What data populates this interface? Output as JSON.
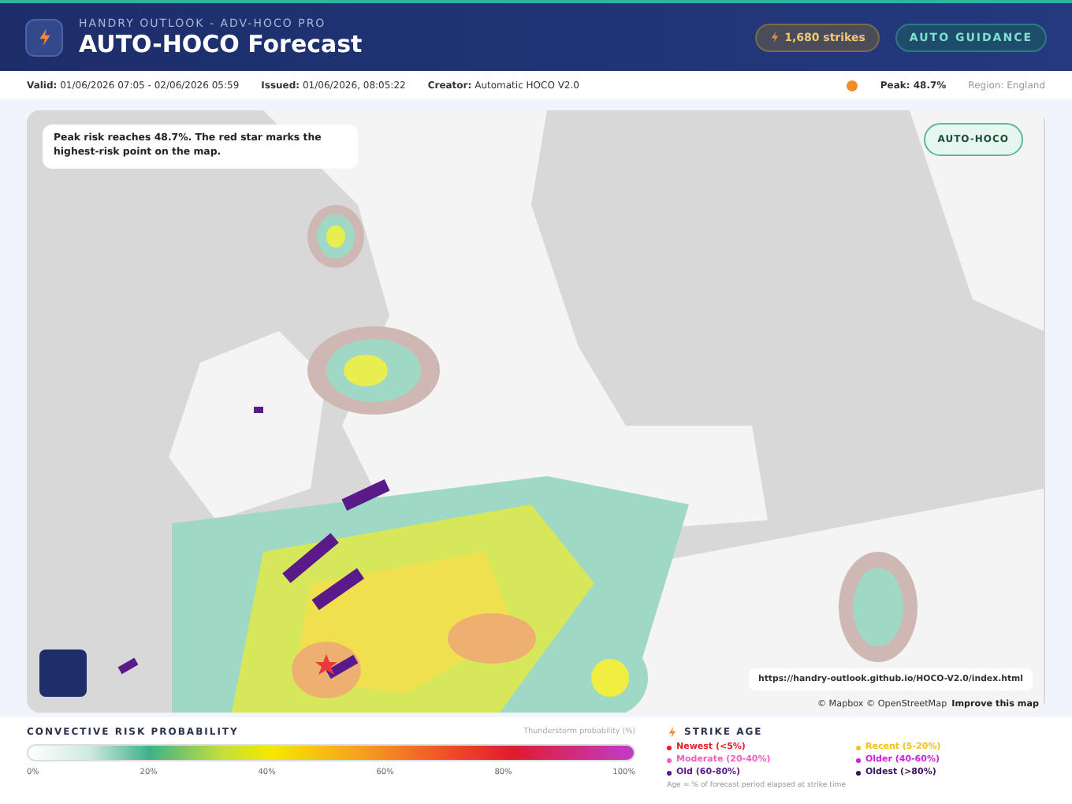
{
  "header": {
    "subtitle": "HANDRY OUTLOOK - ADV-HOCO PRO",
    "title": "AUTO-HOCO Forecast",
    "strikes": "1,680 strikes",
    "guidance": "AUTO GUIDANCE"
  },
  "info_bar": {
    "fields": [
      {
        "label": "Valid:",
        "value": "01/06/2026 07:05 - 02/06/2026 05:59"
      },
      {
        "label": "Issued:",
        "value": "01/06/2026, 08:05:22"
      },
      {
        "label": "Creator:",
        "value": "Automatic HOCO V2.0"
      }
    ],
    "peak": {
      "text": "Peak: 48.7%",
      "color": "#f28c28"
    },
    "region": "Region: England"
  },
  "map": {
    "caption": "Peak risk reaches 48.7%. The red star marks the highest-risk point on the map.",
    "badge": "AUTO-HOCO",
    "url": "https://handry-outlook.github.io/HOCO-V2.0/index.html",
    "attribution": "© Mapbox © OpenStreetMap",
    "improve": "Improve this map"
  },
  "legend": {
    "title": "CONVECTIVE RISK PROBABILITY",
    "note": "Thunderstorm probability (%)",
    "ticks": [
      "0%",
      "20%",
      "40%",
      "60%",
      "80%",
      "100%"
    ]
  },
  "strike_age": {
    "title": "STRIKE AGE",
    "items": [
      {
        "label": "Newest (<5%)",
        "color": "#e8202a"
      },
      {
        "label": "Recent (5-20%)",
        "color": "#f2c318"
      },
      {
        "label": "Moderate (20-40%)",
        "color": "#f060c0"
      },
      {
        "label": "Older (40-60%)",
        "color": "#cc22dd"
      },
      {
        "label": "Old (60-80%)",
        "color": "#5a1a8a"
      },
      {
        "label": "Oldest (>80%)",
        "color": "#3a1060"
      }
    ],
    "note": "Age = % of forecast period elapsed at strike time"
  }
}
